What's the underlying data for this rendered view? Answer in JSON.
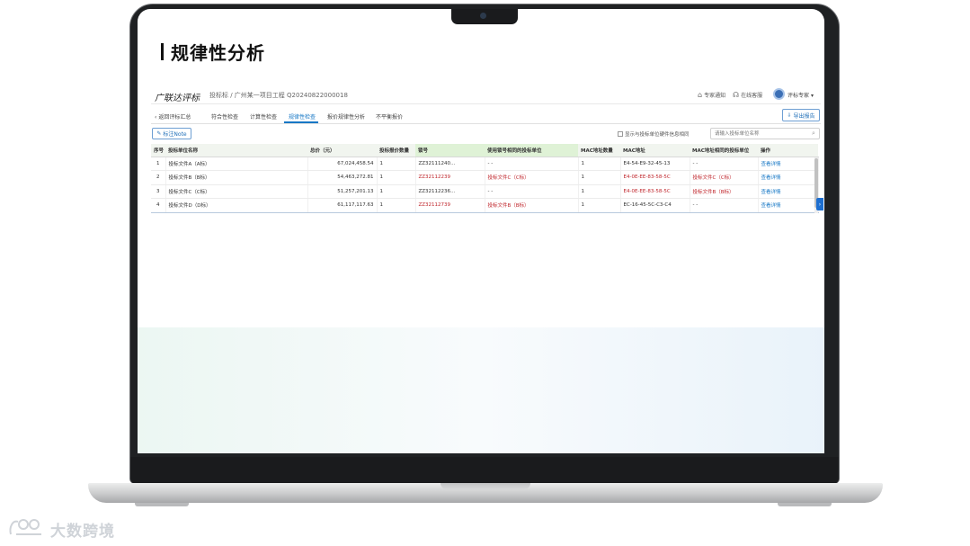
{
  "page_title": "规律性分析",
  "app": {
    "title": "广联达评标",
    "breadcrumb": "投标标 / 广州某一项目工程 Q20240822000018"
  },
  "header": {
    "links": [
      {
        "label": "专家通知",
        "icon": "home-icon"
      },
      {
        "label": "在线客服",
        "icon": "headset-icon"
      }
    ],
    "user": "评标专家"
  },
  "nav": {
    "back_label": "返回评标汇总",
    "tabs": [
      "符合性检查",
      "计算性检查",
      "规律性检查",
      "报价规律性分析",
      "不平衡报价"
    ],
    "active_tab": "规律性检查",
    "export_label": "导出报告"
  },
  "toolbar": {
    "label_button": "标注Note",
    "checkbox_label": "显示与投标单位硬件信息相同",
    "search_placeholder": "请输入投标单位名称"
  },
  "table": {
    "columns": [
      "序号",
      "投标单位名称",
      "总价（元）",
      "投标报价数量",
      "锁号",
      "使用锁号相同的投标单位",
      "MAC地址数量",
      "MAC地址",
      "MAC地址相同的投标单位",
      "操作"
    ],
    "rows": [
      [
        "1",
        "投标文件A（A标）",
        "67,024,458.54",
        "1",
        "ZZ32111240…",
        "- -",
        "1",
        "E4-54-E9-32-45-13",
        "- -",
        "查看详情"
      ],
      [
        "2",
        "投标文件B（B标）",
        "54,463,272.81",
        "1",
        "ZZ32112239",
        "投标文件C（C标）",
        "1",
        "E4-0E-EE-83-58-5C",
        "投标文件C（C标）",
        "查看详情"
      ],
      [
        "3",
        "投标文件C（C标）",
        "51,257,201.13",
        "1",
        "ZZ32112236…",
        "- -",
        "1",
        "E4-0E-EE-83-58-5C",
        "投标文件B（B标）",
        "查看详情"
      ],
      [
        "4",
        "投标文件D（D标）",
        "61,117,117.63",
        "1",
        "ZZ32112739",
        "投标文件B（B标）",
        "1",
        "EC-16-45-5C-C3-C4",
        "- -",
        "查看详情"
      ]
    ]
  },
  "watermark": "大数跨境",
  "colors": {
    "accent": "#1677c5",
    "warning": "#c0272d",
    "header_highlight": "#dff2d6"
  }
}
